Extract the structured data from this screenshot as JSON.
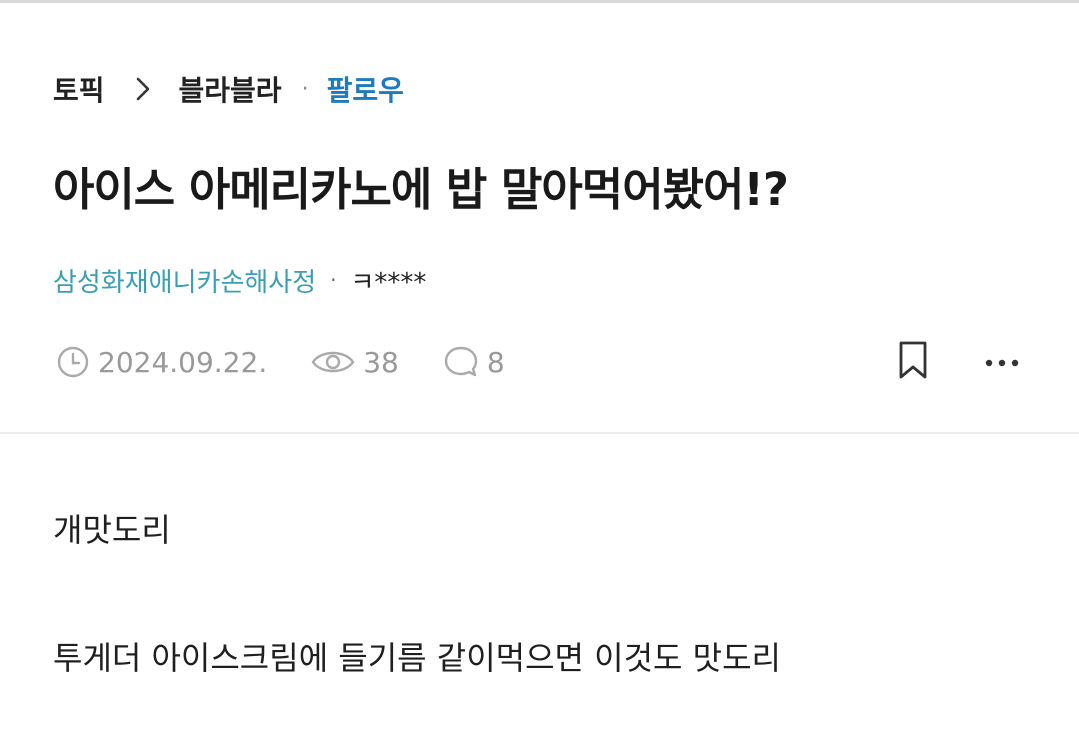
{
  "breadcrumb": {
    "topic": "토픽",
    "board": "블라블라",
    "separator": "·",
    "follow_label": "팔로우"
  },
  "post": {
    "title": "아이스 아메리카노에 밥 말아먹어봤어!?",
    "author_company": "삼성화재애니카손해사정",
    "author_separator": "·",
    "author_nickname": "ㅋ****",
    "date": "2024.09.22.",
    "views": "38",
    "comments": "8",
    "body": [
      "개맛도리",
      "투게더 아이스크림에 들기름 같이먹으면 이것도 맛도리"
    ]
  },
  "icons": {
    "chevron": "chevron-right-icon",
    "clock": "clock-icon",
    "eye": "eye-icon",
    "comment": "comment-bubble-icon",
    "bookmark": "bookmark-icon",
    "more": "more-dots-icon"
  },
  "colors": {
    "follow": "#1f7bbf",
    "company": "#3a9fb0",
    "meta": "#999999"
  }
}
